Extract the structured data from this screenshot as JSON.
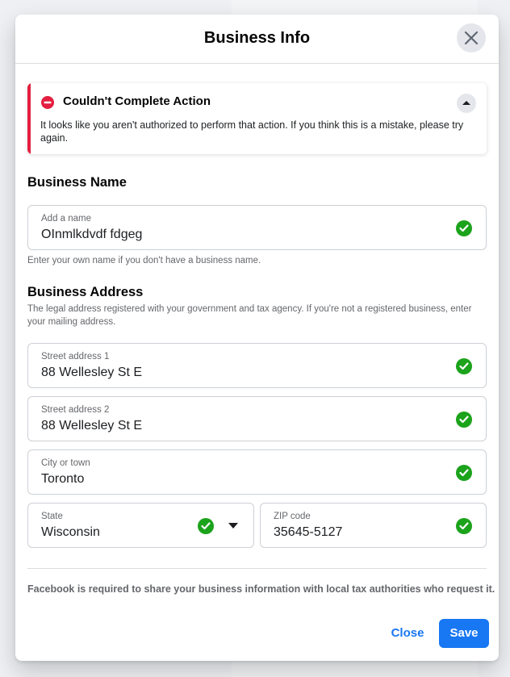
{
  "modal": {
    "title": "Business Info",
    "close_icon": "close-icon"
  },
  "alert": {
    "icon": "error-minus-icon",
    "title": "Couldn't Complete Action",
    "message": "It looks like you aren't authorized to perform that action. If you think this is a mistake, please try again.",
    "collapse_icon": "chevron-up-icon",
    "accent_color": "#e41e3f"
  },
  "business_name": {
    "section_title": "Business Name",
    "field_label": "Add a name",
    "field_value": "OInmlkdvdf fdgeg",
    "helper": "Enter your own name if you don't have a business name."
  },
  "business_address": {
    "section_title": "Business Address",
    "description": "The legal address registered with your government and tax agency. If you're not a registered business, enter your mailing address.",
    "street1": {
      "label": "Street address 1",
      "value": "88 Wellesley St E"
    },
    "street2": {
      "label": "Street address 2",
      "value": "88 Wellesley St E"
    },
    "city": {
      "label": "City or town",
      "value": "Toronto"
    },
    "state": {
      "label": "State",
      "value": "Wisconsin"
    },
    "zip": {
      "label": "ZIP code",
      "value": "35645-5127"
    }
  },
  "disclaimer": "Facebook is required to share your business information with local tax authorities who request it.",
  "footer": {
    "close_label": "Close",
    "save_label": "Save"
  },
  "colors": {
    "primary": "#1877f2",
    "valid": "#1ca31c"
  }
}
